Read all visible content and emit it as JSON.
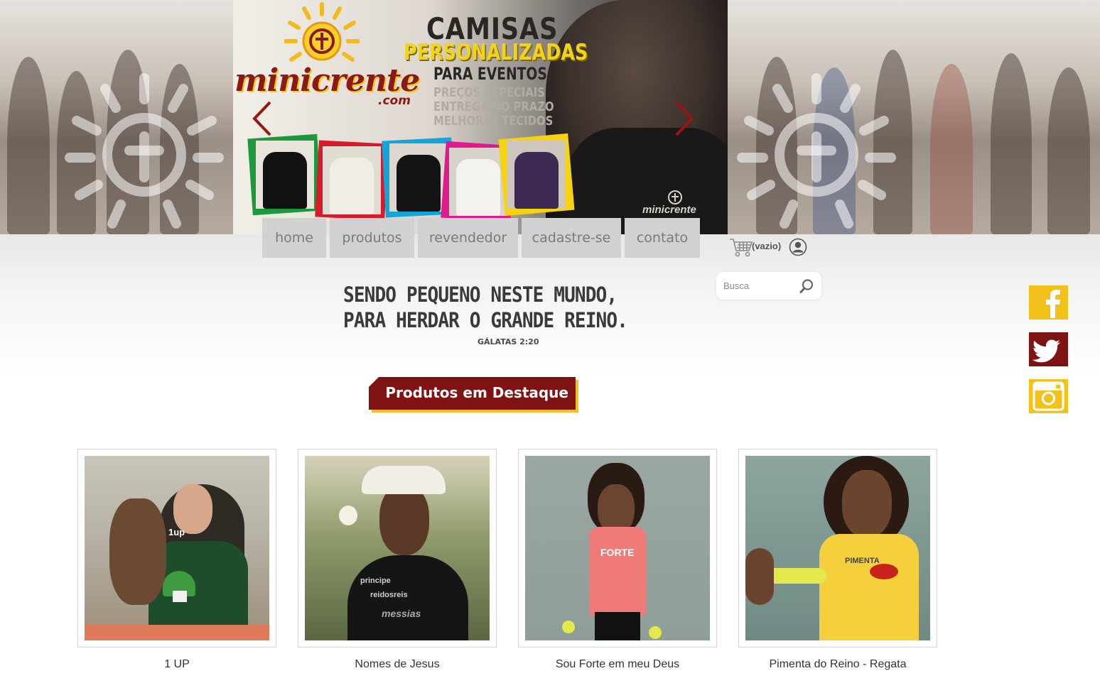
{
  "brand": {
    "logo_word": "minicrente",
    "logo_domain": ".com",
    "shirt_watermark": "minicrente"
  },
  "hero": {
    "headline": "CAMISAS",
    "highlight": "PERSONALIZADAS",
    "subline": "PARA EVENTOS",
    "features": [
      "PREÇOS ESPECIAIS",
      "ENTREGA NO PRAZO",
      "MELHORES TECIDOS"
    ]
  },
  "nav": {
    "items": [
      {
        "label": "home"
      },
      {
        "label": "produtos"
      },
      {
        "label": "revendedor"
      },
      {
        "label": "cadastre-se"
      },
      {
        "label": "contato"
      }
    ]
  },
  "cart": {
    "status": "(vazio)"
  },
  "search": {
    "placeholder": "Busca"
  },
  "verse": {
    "line1": "SENDO PEQUENO NESTE MUNDO,",
    "line2": "PARA HERDAR O GRANDE REINO.",
    "reference": "GÁLATAS 2:20"
  },
  "featured": {
    "title": "Produtos em Destaque",
    "products": [
      {
        "name": "1 UP"
      },
      {
        "name": "Nomes de Jesus"
      },
      {
        "name": "Sou Forte em meu Deus"
      },
      {
        "name": "Pimenta do Reino - Regata"
      }
    ]
  },
  "social": [
    {
      "icon": "facebook-icon",
      "color": "#f2c21b"
    },
    {
      "icon": "twitter-icon",
      "color": "#7f1212"
    },
    {
      "icon": "instagram-icon",
      "color": "#f2c21b"
    }
  ],
  "colors": {
    "brand_red": "#7f1212",
    "brand_yellow": "#f2c21b",
    "nav_bg": "#d1d1d1"
  }
}
